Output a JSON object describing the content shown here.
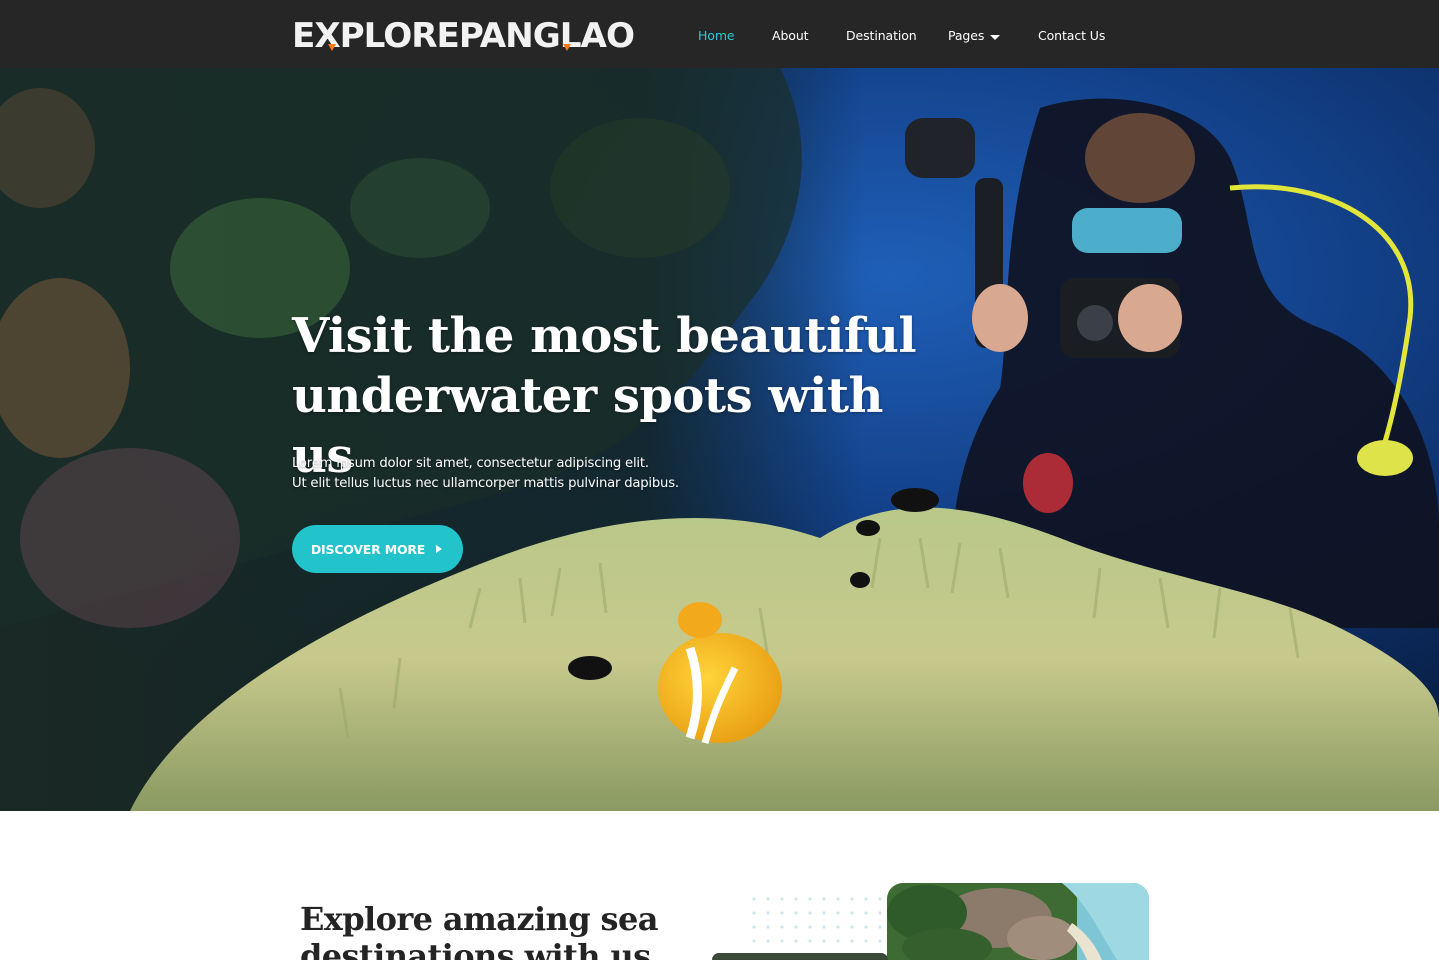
{
  "brand": {
    "logo_text": "EXPLOREPANGLAO"
  },
  "nav": {
    "items": [
      {
        "label": "Home",
        "active": true
      },
      {
        "label": "About"
      },
      {
        "label": "Destination"
      },
      {
        "label": "Pages",
        "has_dropdown": true
      },
      {
        "label": "Contact Us"
      }
    ]
  },
  "hero": {
    "title_line1": "Visit the most beautiful",
    "title_line2": "underwater spots with us",
    "text_line1": "Lorem ipsum dolor sit amet, consectetur adipiscing elit.",
    "text_line2": "Ut elit tellus luctus nec ullamcorper mattis pulvinar dapibus.",
    "cta_label": "DISCOVER MORE"
  },
  "section": {
    "title": "Explore amazing sea destinations with us"
  },
  "colors": {
    "nav_bg": "#262626",
    "accent": "#23c3cc",
    "active_nav": "#2cc8d2"
  }
}
